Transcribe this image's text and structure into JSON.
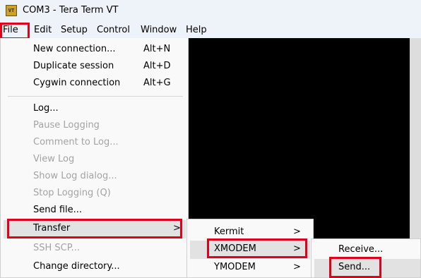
{
  "window": {
    "title": "COM3 - Tera Term VT",
    "icon": "VT",
    "icon_name": "tera-term-icon"
  },
  "menubar": {
    "items": [
      "File",
      "Edit",
      "Setup",
      "Control",
      "Window",
      "Help"
    ]
  },
  "file_menu": {
    "new_connection": {
      "label": "New connection...",
      "shortcut": "Alt+N"
    },
    "duplicate_session": {
      "label": "Duplicate session",
      "shortcut": "Alt+D"
    },
    "cygwin_connection": {
      "label": "Cygwin connection",
      "shortcut": "Alt+G"
    },
    "log": "Log...",
    "pause_logging": "Pause Logging",
    "comment_to_log": "Comment to Log...",
    "view_log": "View Log",
    "show_log_dialog": "Show Log dialog...",
    "stop_logging": "Stop Logging (Q)",
    "send_file": "Send file...",
    "transfer": "Transfer",
    "ssh_scp": "SSH SCP...",
    "change_directory": "Change directory...",
    "submenu_arrow": ">"
  },
  "transfer_menu": {
    "kermit": "Kermit",
    "xmodem": "XMODEM",
    "ymodem": "YMODEM",
    "submenu_arrow": ">"
  },
  "xmodem_menu": {
    "receive": "Receive...",
    "send": "Send..."
  },
  "colors": {
    "highlight_box": "#e0001b",
    "terminal_bg": "#000000",
    "menu_bg": "#f9f9f9",
    "disabled_text": "#a3a3a3"
  }
}
